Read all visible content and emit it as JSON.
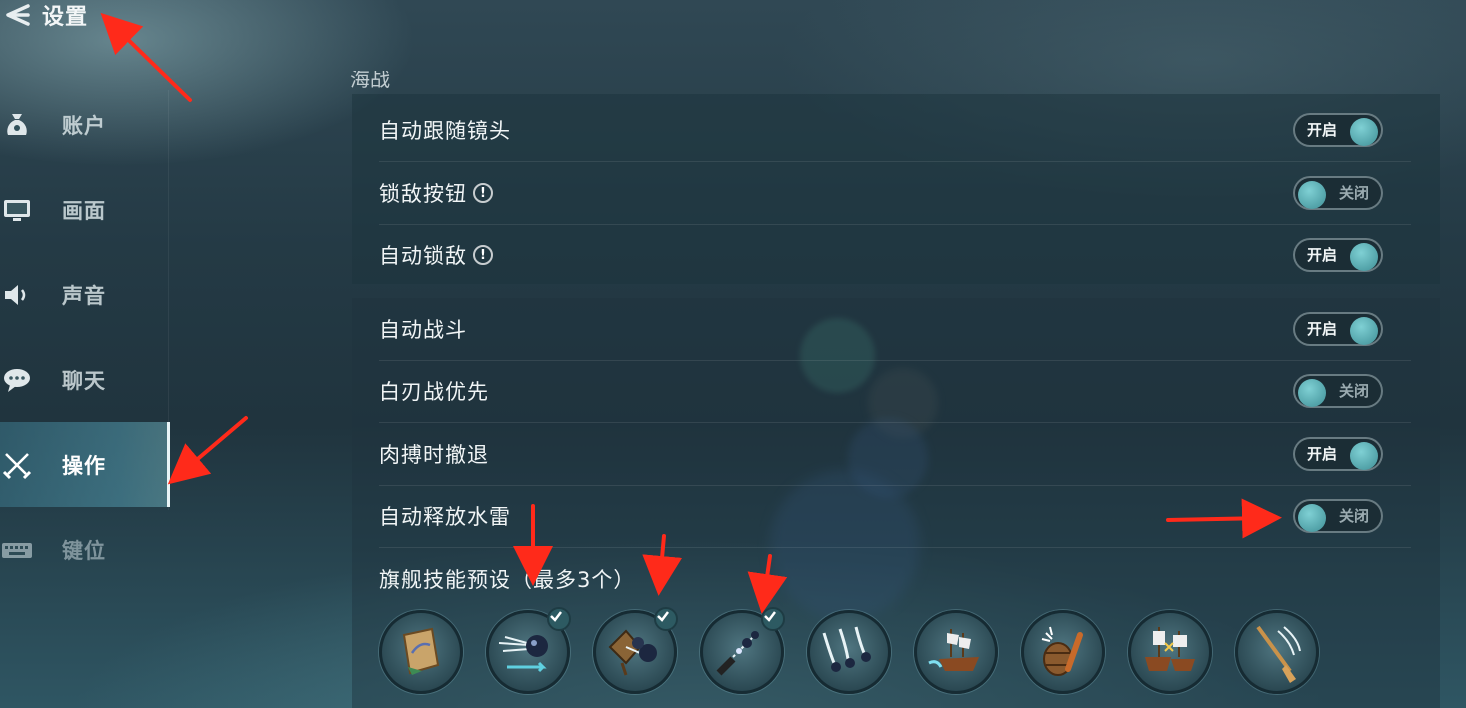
{
  "header": {
    "title": "设置"
  },
  "sidebar": {
    "items": [
      {
        "label": "账户",
        "icon": "moneybag-icon"
      },
      {
        "label": "画面",
        "icon": "monitor-icon"
      },
      {
        "label": "声音",
        "icon": "speaker-icon"
      },
      {
        "label": "聊天",
        "icon": "chat-bubble-icon"
      },
      {
        "label": "操作",
        "icon": "crossed-swords-icon",
        "active": true
      },
      {
        "label": "键位",
        "icon": "keyboard-icon"
      }
    ]
  },
  "section_partial_title": "海战",
  "group1": [
    {
      "label": "自动跟随镜头",
      "state": "开启",
      "on": true,
      "info": false
    },
    {
      "label": "锁敌按钮",
      "state": "关闭",
      "on": false,
      "info": true
    },
    {
      "label": "自动锁敌",
      "state": "开启",
      "on": true,
      "info": true
    }
  ],
  "group2": [
    {
      "label": "自动战斗",
      "state": "开启",
      "on": true
    },
    {
      "label": "白刃战优先",
      "state": "关闭",
      "on": false
    },
    {
      "label": "肉搏时撤退",
      "state": "开启",
      "on": true
    },
    {
      "label": "自动释放水雷",
      "state": "关闭",
      "on": false
    }
  ],
  "skills": {
    "title": "旗舰技能预设（最多3个）",
    "items": [
      {
        "icon": "parchment-map-icon",
        "selected": false
      },
      {
        "icon": "cannonball-dash-icon",
        "selected": true
      },
      {
        "icon": "explosive-barrel-cannonball-icon",
        "selected": true
      },
      {
        "icon": "chain-shot-icon",
        "selected": true
      },
      {
        "icon": "triple-cannonball-icon",
        "selected": false
      },
      {
        "icon": "ship-ramming-icon",
        "selected": false
      },
      {
        "icon": "powder-keg-icon",
        "selected": false
      },
      {
        "icon": "boarding-ships-icon",
        "selected": false
      },
      {
        "icon": "oar-icon",
        "selected": false
      }
    ]
  },
  "colors": {
    "accent": "#4fa7ad",
    "annotation_arrow": "#ff2a1a"
  }
}
